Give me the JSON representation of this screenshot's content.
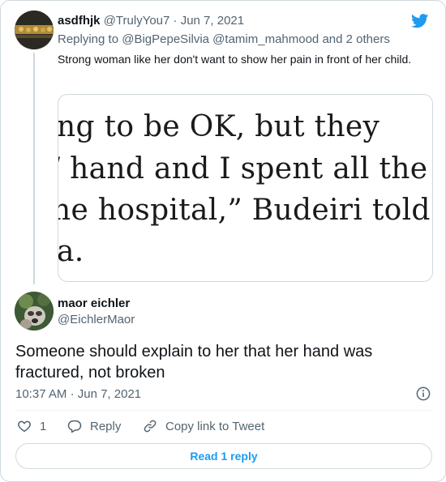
{
  "parent_tweet": {
    "display_name": "asdfhjk",
    "handle": "@TrulyYou7",
    "separator": "·",
    "date": "Jun 7, 2021",
    "replying_prefix": "Replying to",
    "replying_mentions": "@BigPepeSilvia @tamim_mahmood",
    "replying_suffix": "and 2 others",
    "text": "Strong woman like her don't want to show her pain in front of her child.",
    "media_text_lines": [
      "ng to be OK, but they",
      "/ hand and I spent all the",
      "he hospital,” Budeiri told",
      "a."
    ]
  },
  "main_tweet": {
    "display_name": "maor eichler",
    "handle": "@EichlerMaor",
    "text": "Someone should explain to her that her hand was fractured, not broken",
    "time": "10:37 AM",
    "separator": "·",
    "date": "Jun 7, 2021"
  },
  "actions": {
    "like_count": "1",
    "reply_label": "Reply",
    "copy_link_label": "Copy link to Tweet"
  },
  "read_replies_label": "Read 1 reply",
  "icons": {
    "brand": "twitter-bird-icon",
    "info": "info-icon",
    "like": "heart-icon",
    "reply": "reply-bubble-icon",
    "copy": "link-icon"
  },
  "colors": {
    "brand_blue": "#1d9bf0",
    "text_primary": "#0f1419",
    "text_secondary": "#536471",
    "border": "#cfd9de"
  }
}
